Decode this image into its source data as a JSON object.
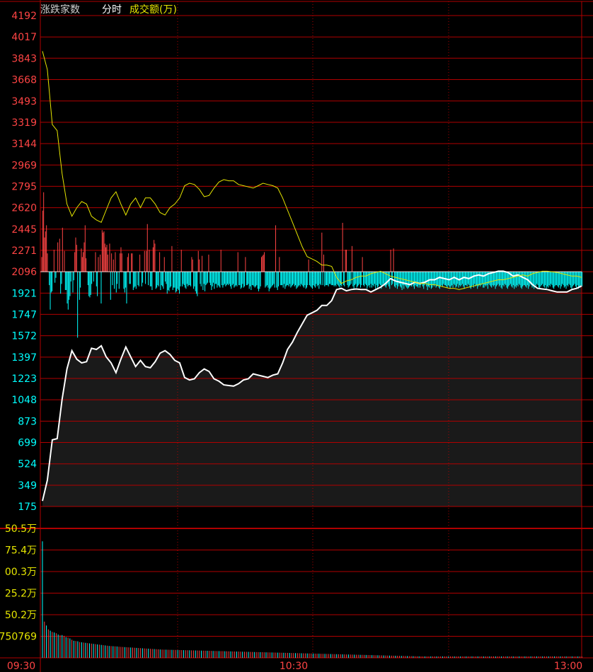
{
  "header": {
    "title": "涨跌家数",
    "mode": "分时",
    "amount_label": "成交额(万)"
  },
  "colors": {
    "grid": "#b00000",
    "axis_up": "#ff4444",
    "axis_down": "#00ffff",
    "amount_axis": "#e6e600",
    "white_line": "#ffffff",
    "yellow_line": "#e6e600",
    "up_bar": "#ff4444",
    "down_bar": "#00ffff",
    "fill": "#1a1a1a"
  },
  "chart_data": [
    {
      "type": "line",
      "ylim": [
        175,
        4192
      ],
      "baseline": 2096,
      "y_ticks_up": [
        "4192",
        "4017",
        "3843",
        "3668",
        "3493",
        "3319",
        "3144",
        "2969",
        "2795",
        "2620",
        "2445",
        "2271",
        "2096"
      ],
      "y_ticks_down": [
        "1921",
        "1747",
        "1572",
        "1397",
        "1223",
        "1048",
        "873",
        "699",
        "524",
        "349",
        "175"
      ],
      "x_ticks": [
        "09:30",
        "10:30",
        "13:00"
      ],
      "series": [
        {
          "key": "white",
          "values": [
            220,
            390,
            720,
            730,
            1050,
            1300,
            1450,
            1380,
            1350,
            1360,
            1470,
            1460,
            1490,
            1400,
            1350,
            1270,
            1380,
            1480,
            1400,
            1320,
            1370,
            1320,
            1310,
            1360,
            1430,
            1450,
            1420,
            1370,
            1350,
            1230,
            1210,
            1220,
            1270,
            1300,
            1280,
            1220,
            1200,
            1170,
            1165,
            1160,
            1180,
            1210,
            1220,
            1260,
            1250,
            1240,
            1230,
            1250,
            1260,
            1350,
            1460,
            1520,
            1600,
            1670,
            1740,
            1760,
            1780,
            1820,
            1820,
            1860,
            1950,
            1960,
            1940,
            1950,
            1955,
            1950,
            1950,
            1930,
            1950,
            1970,
            2000,
            2040,
            2020,
            2010,
            2000,
            1990,
            2010,
            2000,
            2010,
            2030,
            2030,
            2050,
            2040,
            2030,
            2050,
            2030,
            2050,
            2040,
            2060,
            2070,
            2060,
            2080,
            2090,
            2100,
            2100,
            2090,
            2060,
            2070,
            2050,
            2030,
            1990,
            1960,
            1955,
            1950,
            1940,
            1930,
            1930,
            1930,
            1950,
            1960,
            1980
          ]
        },
        {
          "key": "yellow",
          "values": [
            3900,
            3750,
            3300,
            3250,
            2900,
            2650,
            2550,
            2620,
            2670,
            2650,
            2550,
            2520,
            2500,
            2600,
            2700,
            2750,
            2650,
            2560,
            2650,
            2700,
            2620,
            2700,
            2700,
            2650,
            2580,
            2560,
            2620,
            2650,
            2700,
            2800,
            2820,
            2810,
            2770,
            2710,
            2720,
            2780,
            2830,
            2850,
            2840,
            2840,
            2810,
            2800,
            2790,
            2780,
            2800,
            2820,
            2810,
            2800,
            2780,
            2700,
            2600,
            2500,
            2400,
            2300,
            2220,
            2200,
            2180,
            2150,
            2150,
            2140,
            2050,
            2000,
            2020,
            2030,
            2050,
            2060,
            2060,
            2080,
            2090,
            2100,
            2080,
            2060,
            2050,
            2040,
            2030,
            2020,
            2010,
            2000,
            2000,
            1990,
            1990,
            1980,
            1970,
            1960,
            1960,
            1950,
            1960,
            1970,
            1980,
            1990,
            2000,
            2010,
            2020,
            2030,
            2030,
            2040,
            2050,
            2060,
            2070,
            2060,
            2080,
            2090,
            2100,
            2100,
            2095,
            2090,
            2080,
            2070,
            2060,
            2060,
            2050
          ]
        }
      ],
      "breadth_bars": [
        120,
        500,
        650,
        280,
        330,
        380,
        150,
        0,
        -110,
        -310,
        -170,
        -160,
        0,
        180,
        -90,
        -50,
        0,
        240,
        0,
        270,
        -180,
        -100,
        360,
        0,
        170,
        -150,
        -150,
        -260,
        -310,
        -230,
        -200,
        -80,
        0,
        -170,
        -70,
        160,
        280,
        220,
        -540,
        0,
        -230,
        -130,
        190,
        120,
        160,
        240,
        380,
        110,
        0,
        -110,
        -200,
        -210,
        -190,
        -100,
        0,
        -80,
        0,
        160,
        -120,
        -200,
        120,
        0,
        140,
        -260,
        340,
        320,
        330,
        230,
        200,
        220,
        140,
        0,
        230,
        -230,
        150,
        -110,
        100,
        -140,
        160,
        -170,
        -100,
        0,
        -140,
        150,
        200,
        150,
        0,
        -140,
        -170,
        -130,
        -260,
        120,
        150,
        -100,
        -100,
        150,
        150,
        -150,
        -130,
        -120,
        -140,
        0,
        -110,
        -120,
        140,
        0,
        -120,
        -90,
        0,
        170,
        -100,
        170,
        390,
        -110,
        180,
        -120,
        -120,
        -150,
        200,
        260,
        230,
        -140,
        -130,
        -110,
        -120,
        160,
        -150,
        -110,
        -120,
        -140,
        120,
        -80,
        -100,
        -180,
        -150,
        -160,
        -130,
        -120,
        210,
        -150,
        -130,
        -130,
        -170,
        -160,
        -140,
        -150,
        -180,
        -120,
        180,
        -120,
        -100,
        -110,
        -130,
        -140,
        -100,
        -120,
        -110,
        -110,
        -120,
        120,
        100,
        -140,
        -120,
        -160,
        -180,
        -200,
        170,
        100,
        -100,
        -120,
        130,
        -150,
        -100,
        -160,
        -110,
        -100,
        -90,
        140,
        -90,
        -110,
        -150,
        -120,
        -90,
        -140,
        -100,
        -100,
        -130,
        -110,
        -120,
        -130,
        180,
        -110,
        -130,
        -110,
        -100,
        -120,
        -110,
        -100,
        -110,
        -100,
        -120,
        -140,
        -110,
        -100,
        -130,
        -120,
        -110,
        -120,
        160,
        -110,
        -110,
        -140,
        -130,
        -100,
        -130,
        -120,
        120,
        -110,
        -110,
        -100,
        -140,
        -120,
        -150,
        -110,
        -110,
        -120,
        -130,
        -120,
        -110,
        -140,
        -160,
        -140,
        -120,
        120,
        130,
        140,
        160,
        -130,
        -120,
        -110,
        -130,
        -160,
        -140,
        -130,
        -120,
        -110,
        -100,
        -130,
        380,
        -130,
        -150,
        -120,
        120,
        -110,
        -110,
        -110,
        -130,
        -100,
        -140,
        -120,
        -110,
        -110,
        -120,
        -100,
        -130,
        -120,
        -110,
        -100,
        -120,
        -110,
        -140,
        -130,
        -120,
        -110,
        -120,
        -100,
        -110,
        -120,
        -130,
        -110,
        -140,
        -130,
        -110,
        100,
        -110,
        -120,
        -130,
        -140,
        -110,
        -120,
        -130,
        -100,
        -120,
        -110,
        -140,
        -100,
        -110,
        320,
        -110,
        140,
        -120,
        -110,
        -110,
        -110,
        -120,
        -100,
        -100,
        -110,
        -110,
        -110,
        -120,
        -110,
        -120,
        -100,
        -110,
        -120,
        -130,
        -110,
        -120,
        400,
        -110,
        -120,
        180,
        180,
        -110,
        -130,
        -120,
        -110,
        -100,
        210,
        -120,
        -140,
        -110,
        -100,
        -130,
        -120,
        -110,
        -100,
        -130,
        -110,
        120,
        -110,
        -120,
        -100,
        -110,
        -140,
        -120,
        -110,
        -130,
        -100,
        -130,
        -110,
        -120,
        -100,
        -140,
        -110,
        -130,
        -120,
        -100,
        -110,
        -140,
        -120,
        -100,
        -110,
        -120,
        -130,
        -110,
        -100,
        -120,
        -140,
        180,
        -110,
        -100,
        190,
        -120,
        -130,
        -110,
        -140,
        -120,
        -100,
        -120,
        -130,
        -150,
        -110,
        -140,
        -110,
        -120,
        -130,
        -140,
        -130,
        -120,
        -110,
        -120,
        -100,
        -120,
        -140,
        -110,
        -120,
        -120,
        -130,
        -110,
        -130,
        -110,
        -100,
        -120,
        -140,
        -110,
        -100,
        -120,
        -150,
        -120,
        -130,
        -110,
        -140,
        -130,
        -110,
        -120,
        -100,
        -130,
        -120,
        -110,
        -130,
        -140,
        -120,
        -110,
        -120,
        -100,
        -110,
        -110,
        -120,
        -130,
        -110,
        -120,
        -140,
        -120,
        -110,
        -130,
        -100,
        -110,
        -130,
        -120,
        -100,
        -130,
        -110,
        -120,
        -110,
        -100,
        -120,
        -140,
        -110,
        -110,
        -120,
        -100,
        -110,
        -130,
        -140,
        -120,
        -110,
        -130,
        -100,
        -120,
        -110,
        -140,
        -120,
        -110,
        -120,
        -110,
        -100,
        -130,
        -130,
        -110,
        -120,
        -110,
        -140,
        -100,
        -110,
        -120,
        -130,
        -110,
        -120,
        -110,
        -140,
        -120,
        -110,
        -100,
        -120,
        -110,
        -130,
        -140,
        -110,
        -120,
        -100,
        -110,
        -130,
        -140,
        -120,
        -110,
        -100,
        -120,
        -130,
        -110,
        -140,
        -120,
        -130,
        -110,
        -120,
        -100,
        -110,
        -130,
        -140,
        -120,
        -110,
        -110,
        -120,
        -130,
        -110,
        -140,
        -120,
        -100,
        -110,
        -130,
        -120,
        -140,
        -110,
        -120,
        -100,
        -110,
        -130,
        -140,
        -120,
        -110,
        -100,
        -120,
        -130,
        -110,
        -140,
        -120,
        -130,
        -110,
        -120,
        -100,
        -110,
        -130,
        -140,
        -120,
        -110,
        -110,
        -120,
        -130,
        -110,
        -140,
        -120,
        -100,
        -110,
        -130,
        -120,
        -140,
        -110,
        -120,
        -100,
        -110,
        -130,
        -140,
        -120,
        -110,
        -100,
        -120,
        -130,
        -110,
        -140,
        -120,
        -130,
        -110,
        -120
      ]
    },
    {
      "type": "bar",
      "y_ticks": [
        "50.5万",
        "75.4万",
        "00.3万",
        "25.2万",
        "50.2万",
        "750769"
      ],
      "ylim": [
        0,
        5000000
      ],
      "values": [
        4500000,
        1400000,
        1250000,
        1100000,
        1050000,
        1000000,
        980000,
        950000,
        900000,
        870000,
        880000,
        850000,
        800000,
        780000,
        750769,
        700000,
        660000,
        650000,
        640000,
        610000,
        600000,
        590000,
        580000,
        570000,
        560000,
        550000,
        540000,
        530000,
        520000,
        510000,
        500000,
        490000,
        480000,
        470000,
        460000,
        455000,
        450000,
        445000,
        440000,
        430000,
        425000,
        420000,
        415000,
        410000,
        405000,
        400000,
        395000,
        390000,
        385000,
        380000,
        375000,
        370000,
        365000,
        360000,
        355000,
        350000,
        345000,
        340000,
        335000,
        330000,
        325000,
        320000,
        318000,
        316000,
        314000,
        312000,
        310000,
        308000,
        306000,
        304000,
        302000,
        300000,
        298000,
        296000,
        294000,
        292000,
        290000,
        288000,
        286000,
        284000,
        282000,
        280000,
        278000,
        276000,
        274000,
        272000,
        270000,
        268000,
        266000,
        264000,
        262000,
        260000,
        258000,
        256000,
        254000,
        252000,
        250000,
        248000,
        246000,
        244000,
        242000,
        240000,
        238000,
        236000,
        234000,
        232000,
        230000,
        228000,
        226000,
        224000,
        222000,
        220000,
        218000,
        216000,
        214000,
        212000,
        210000,
        208000,
        206000,
        204000,
        202000,
        200000,
        198000,
        196000,
        194000,
        192000,
        190000,
        188000,
        186000,
        184000,
        182000,
        180000,
        178000,
        176000,
        174000,
        172000,
        170000,
        168000,
        166000,
        164000,
        162000,
        160000,
        158000,
        156000,
        154000,
        152000,
        150000,
        148000,
        146000,
        144000,
        142000,
        140000,
        138000,
        136000,
        134000,
        132000,
        130000,
        128000,
        126000,
        124000,
        122000,
        120000,
        118000,
        116000,
        114000,
        112000,
        110000,
        108000,
        106000,
        104000,
        102000,
        100000,
        98000,
        96000,
        94000,
        92000,
        90000,
        88000,
        86000,
        84000,
        82000,
        80000,
        78000,
        76000,
        74000,
        72000,
        70000,
        68000,
        66000,
        64000,
        62000,
        60000,
        58000,
        56000,
        54000,
        52000,
        50000,
        48000,
        46000,
        44000,
        42000,
        40000,
        38000,
        36000,
        34000,
        32000,
        30000,
        28000,
        26000,
        24000,
        22000,
        20000,
        18000,
        16000,
        14000,
        12000,
        10000,
        8000,
        6000,
        4000,
        2000,
        1000,
        1000,
        1000,
        1000,
        1000,
        1000,
        1000,
        1000,
        1000,
        1000,
        1000,
        1000,
        1000,
        1000,
        1000,
        1000,
        1000,
        1000,
        1000,
        1000,
        1000,
        1000,
        1000,
        1000,
        1000,
        1000,
        1000,
        1000,
        1000,
        1000,
        1000,
        1000,
        1000,
        1000,
        1000,
        1000,
        1000,
        1000,
        1000,
        1000,
        1000,
        1000,
        1000,
        1000,
        1000,
        1000,
        1000,
        1000,
        1000,
        1000,
        1000,
        1000,
        1000,
        1000,
        1000
      ]
    }
  ]
}
